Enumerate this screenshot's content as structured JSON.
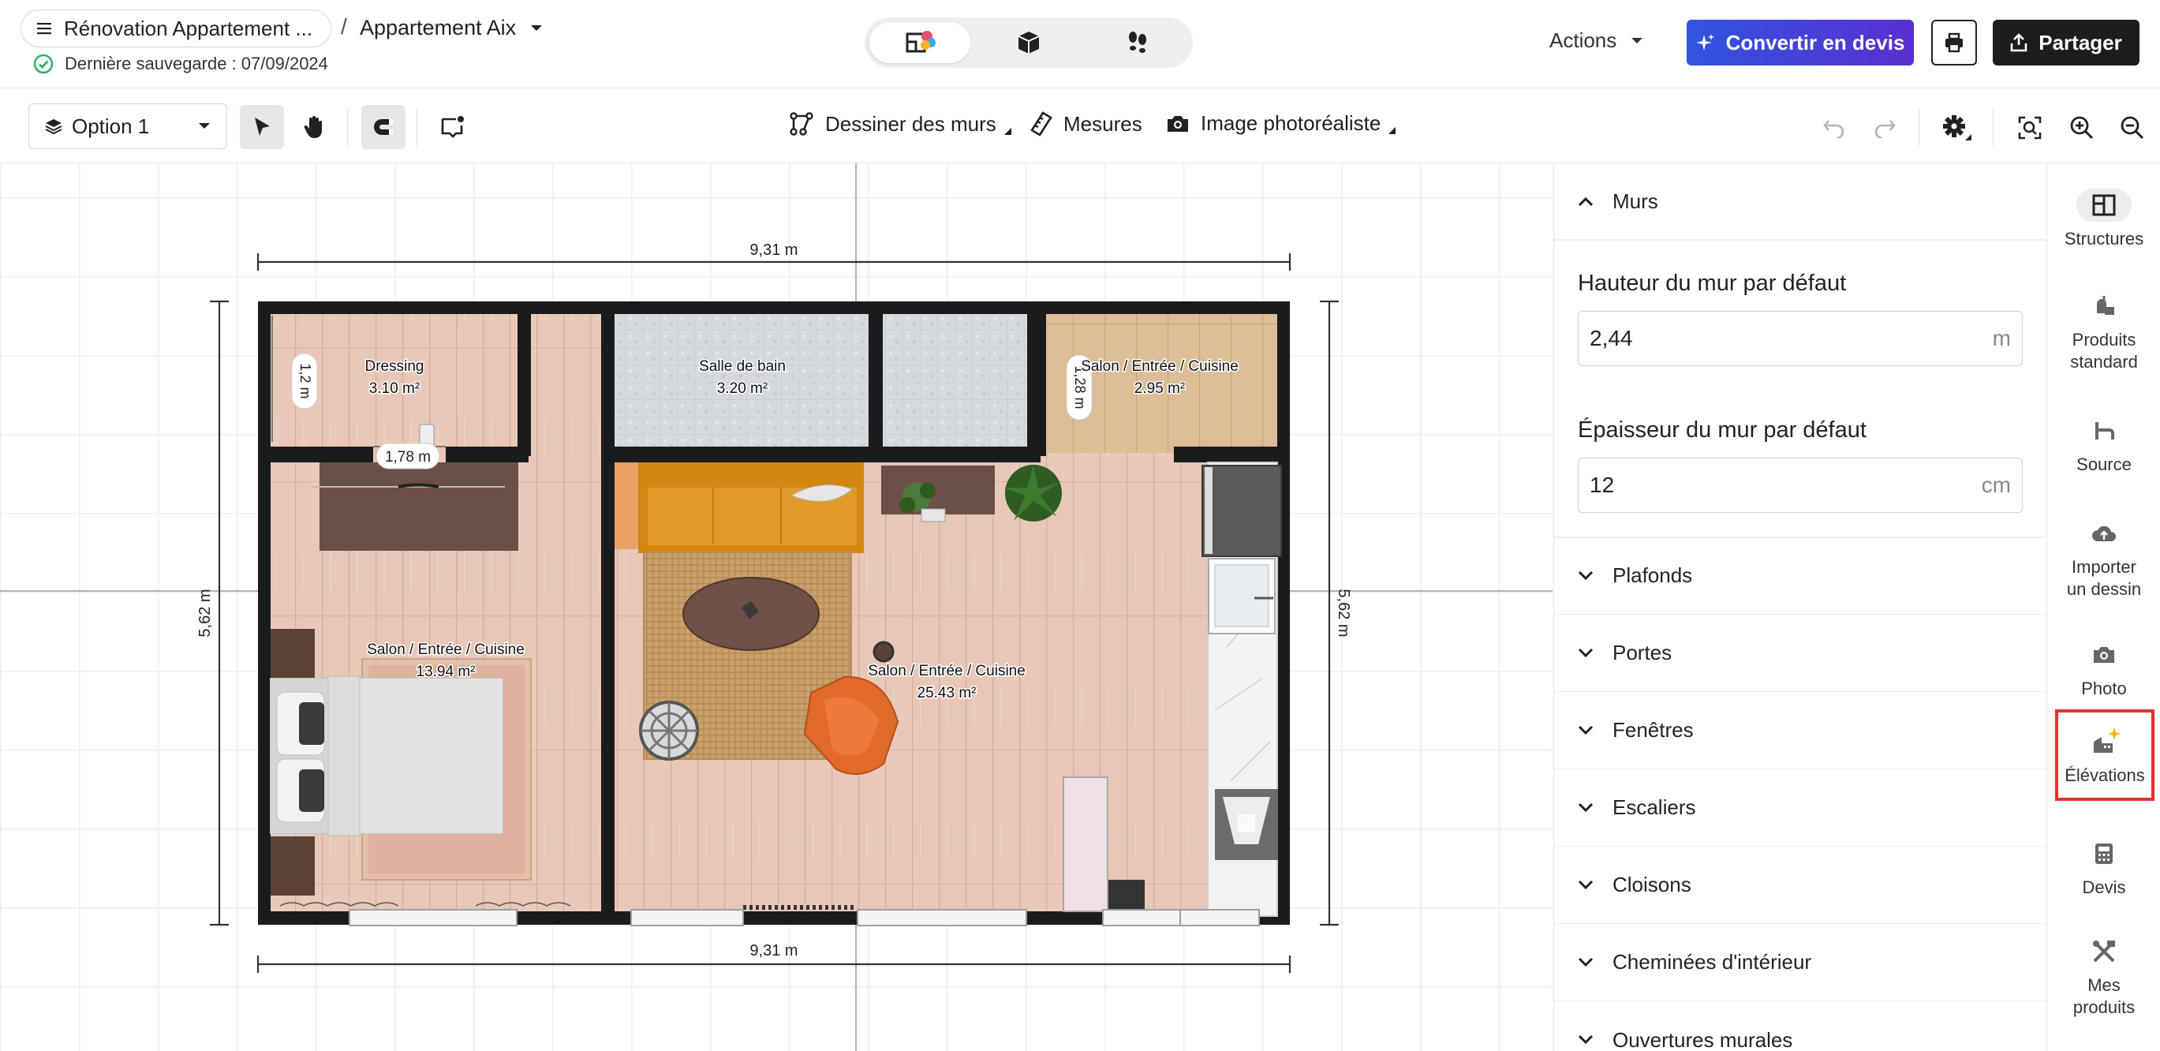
{
  "header": {
    "project_name": "Rénovation Appartement ...",
    "separator": "/",
    "apartment_name": "Appartement Aix",
    "saved_text": "Dernière sauvegarde : 07/09/2024",
    "actions_label": "Actions",
    "convert_label": "Convertir en devis",
    "share_label": "Partager"
  },
  "toolbar": {
    "option_label": "Option 1",
    "draw_walls_label": "Dessiner des murs",
    "measures_label": "Mesures",
    "photo_label": "Image photoréaliste"
  },
  "plan": {
    "dim_top": "9,31 m",
    "dim_bottom": "9,31 m",
    "dim_left": "5,62 m",
    "dim_right": "5,62 m",
    "dim_dressing_v": "1,2 m",
    "dim_dressing_h": "1,78 m",
    "dim_room3_v": "1,28 m",
    "rooms": [
      {
        "name": "Dressing",
        "area": "3.10 m²"
      },
      {
        "name": "Salle de bain",
        "area": "3.20 m²"
      },
      {
        "name": "Salon / Entrée / Cuisine",
        "area": "2.95 m²"
      },
      {
        "name": "Salon / Entrée / Cuisine",
        "area": "13.94 m²"
      },
      {
        "name": "Salon / Entrée / Cuisine",
        "area": "25.43 m²"
      }
    ]
  },
  "panel": {
    "murs_title": "Murs",
    "height_label": "Hauteur du mur par défaut",
    "height_value": "2,44",
    "height_unit": "m",
    "thickness_label": "Épaisseur du mur par défaut",
    "thickness_value": "12",
    "thickness_unit": "cm",
    "sections": [
      "Plafonds",
      "Portes",
      "Fenêtres",
      "Escaliers",
      "Cloisons",
      "Cheminées d'intérieur",
      "Ouvertures murales"
    ]
  },
  "rail": {
    "items": [
      {
        "label1": "Structures",
        "label2": ""
      },
      {
        "label1": "Produits",
        "label2": "standard"
      },
      {
        "label1": "Source",
        "label2": ""
      },
      {
        "label1": "Importer",
        "label2": "un dessin"
      },
      {
        "label1": "Photo",
        "label2": ""
      },
      {
        "label1": "Élévations",
        "label2": ""
      },
      {
        "label1": "Devis",
        "label2": ""
      },
      {
        "label1": "Mes",
        "label2": "produits"
      }
    ]
  },
  "colors": {
    "accent_gradient_start": "#3054e0",
    "accent_gradient_end": "#5a2fd0",
    "wall": "#1b1b1b",
    "floor": "#e8c6b6",
    "highlight": "#e4312b",
    "saved_check": "#2fb46e",
    "star": "#f2b824"
  },
  "icons": [
    "menu-icon",
    "chevron-down-icon",
    "check-circle-icon",
    "plan-2d-icon",
    "box-3d-icon",
    "footsteps-icon",
    "sparkle-icon",
    "printer-icon",
    "share-upload-icon",
    "layers-icon",
    "cursor-icon",
    "hand-icon",
    "magnet-icon",
    "room-tag-icon",
    "draw-walls-icon",
    "ruler-icon",
    "camera-icon",
    "undo-icon",
    "redo-icon",
    "gear-icon",
    "focus-icon",
    "zoom-in-icon",
    "zoom-out-icon",
    "chevron-up-icon",
    "structures-icon",
    "products-icon",
    "source-icon",
    "cloud-upload-icon",
    "photo-icon",
    "elevations-icon",
    "calculator-icon",
    "my-products-icon"
  ]
}
